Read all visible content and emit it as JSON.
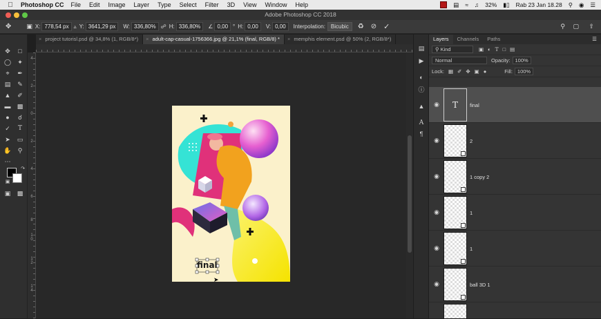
{
  "menubar": {
    "app_name": "Photoshop CC",
    "items": [
      "File",
      "Edit",
      "Image",
      "Layer",
      "Type",
      "Select",
      "Filter",
      "3D",
      "View",
      "Window",
      "Help"
    ],
    "battery": "32%",
    "datetime": "Rab 23 Jan  18.28"
  },
  "window": {
    "title": "Adobe Photoshop CC 2018"
  },
  "options": {
    "x_label": "X:",
    "x_value": "778,54 px",
    "y_label": "Y:",
    "y_value": "3641,29 px",
    "w_label": "W:",
    "w_value": "336,80%",
    "h_label": "H:",
    "h_value": "336,80%",
    "angle_value": "0,00",
    "hskew_label": "H:",
    "hskew_value": "0,00",
    "vskew_label": "V:",
    "vskew_value": "0,00",
    "interp_label": "Interpolation:",
    "interp_value": "Bicubic"
  },
  "tabs": [
    {
      "label": "project tutorisl.psd @ 34,8% (1, RGB/8*)",
      "active": false
    },
    {
      "label": "adult-cap-casual-1756366.jpg @ 21,1% (final, RGB/8) *",
      "active": true
    },
    {
      "label": "memphis element.psd @ 50% (2, RGB/8*)",
      "active": false
    }
  ],
  "ruler_labels": [
    "4",
    "2",
    "0",
    "2",
    "4",
    "6",
    "8",
    "1 0",
    "1 2",
    "1 4"
  ],
  "canvas": {
    "text": "final"
  },
  "layers_panel": {
    "tabs": [
      "Layers",
      "Channels",
      "Paths"
    ],
    "kind_label": "Kind",
    "blend_mode": "Normal",
    "opacity_label": "Opacity:",
    "opacity_value": "100%",
    "lock_label": "Lock:",
    "fill_label": "Fill:",
    "fill_value": "100%",
    "layers": [
      {
        "name": "final",
        "type": "text",
        "active": true
      },
      {
        "name": "2",
        "type": "smart"
      },
      {
        "name": "1 copy 2",
        "type": "smart"
      },
      {
        "name": "1",
        "type": "smart"
      },
      {
        "name": "1",
        "type": "smart"
      },
      {
        "name": "ball 3D 1",
        "type": "smart"
      }
    ]
  },
  "colors": {
    "accent_pink": "#e0317a",
    "accent_cyan": "#35e3d5",
    "accent_yellow": "#f9f02a",
    "doc_bg": "#fbf1cb"
  }
}
